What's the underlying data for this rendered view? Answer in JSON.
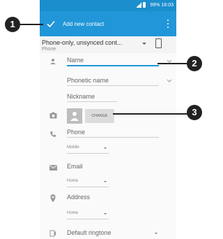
{
  "status_bar": {
    "text": "99% 16:03"
  },
  "toolbar": {
    "title": "Add new contact"
  },
  "account": {
    "title": "Phone-only, unsynced cont...",
    "subtitle": "Phone"
  },
  "fields": {
    "name": "Name",
    "phonetic": "Phonetic name",
    "nickname": "Nickname",
    "photo_button": "CHANGE",
    "phone": "Phone",
    "phone_type": "Mobile",
    "email": "Email",
    "email_type": "Home",
    "address": "Address",
    "address_type": "Home",
    "ringtone": "Default ringtone"
  },
  "callouts": [
    "1",
    "2",
    "3"
  ],
  "colors": {
    "status_bar": "#1b8ecd",
    "toolbar": "#2196d8",
    "callout": "#222222"
  },
  "icons": [
    "check-icon",
    "overflow-menu-icon",
    "phone-device-icon",
    "person-icon",
    "camera-icon",
    "phone-icon",
    "email-icon",
    "location-icon",
    "ringtone-icon",
    "expand-icon"
  ]
}
